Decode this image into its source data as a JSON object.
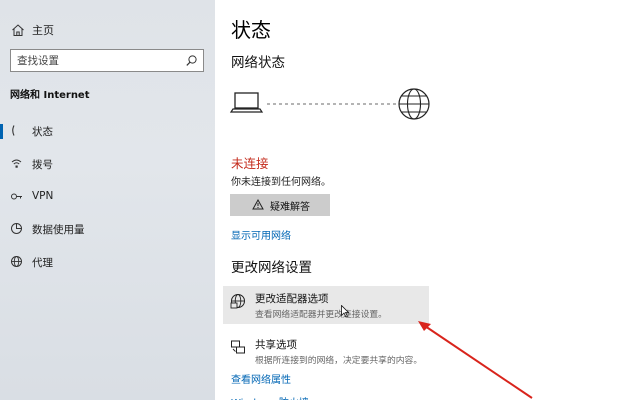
{
  "sidebar": {
    "home_label": "主页",
    "search_placeholder": "查找设置",
    "section_title": "网络和 Internet",
    "items": [
      {
        "label": "状态",
        "icon": "status-icon",
        "active": true
      },
      {
        "label": "拨号",
        "icon": "dialup-icon",
        "active": false
      },
      {
        "label": "VPN",
        "icon": "vpn-icon",
        "active": false
      },
      {
        "label": "数据使用量",
        "icon": "data-usage-icon",
        "active": false
      },
      {
        "label": "代理",
        "icon": "proxy-icon",
        "active": false
      }
    ]
  },
  "main": {
    "title": "状态",
    "network_status_heading": "网络状态",
    "status": "未连接",
    "status_description": "你未连接到任何网络。",
    "troubleshoot_label": "疑难解答",
    "show_networks_link": "显示可用网络",
    "change_settings_heading": "更改网络设置",
    "options": [
      {
        "title": "更改适配器选项",
        "description": "查看网络适配器并更改连接设置。",
        "icon": "adapter-globe-icon"
      },
      {
        "title": "共享选项",
        "description": "根据所连接到的网络，决定要共享的内容。",
        "icon": "sharing-icon"
      }
    ],
    "view_properties_link": "查看网络属性",
    "cut_off_link": "Windows 防火墙"
  },
  "colors": {
    "accent": "#0063b1",
    "link": "#0066b4",
    "error": "#c42b1c",
    "annotation_arrow": "#d9241c"
  }
}
